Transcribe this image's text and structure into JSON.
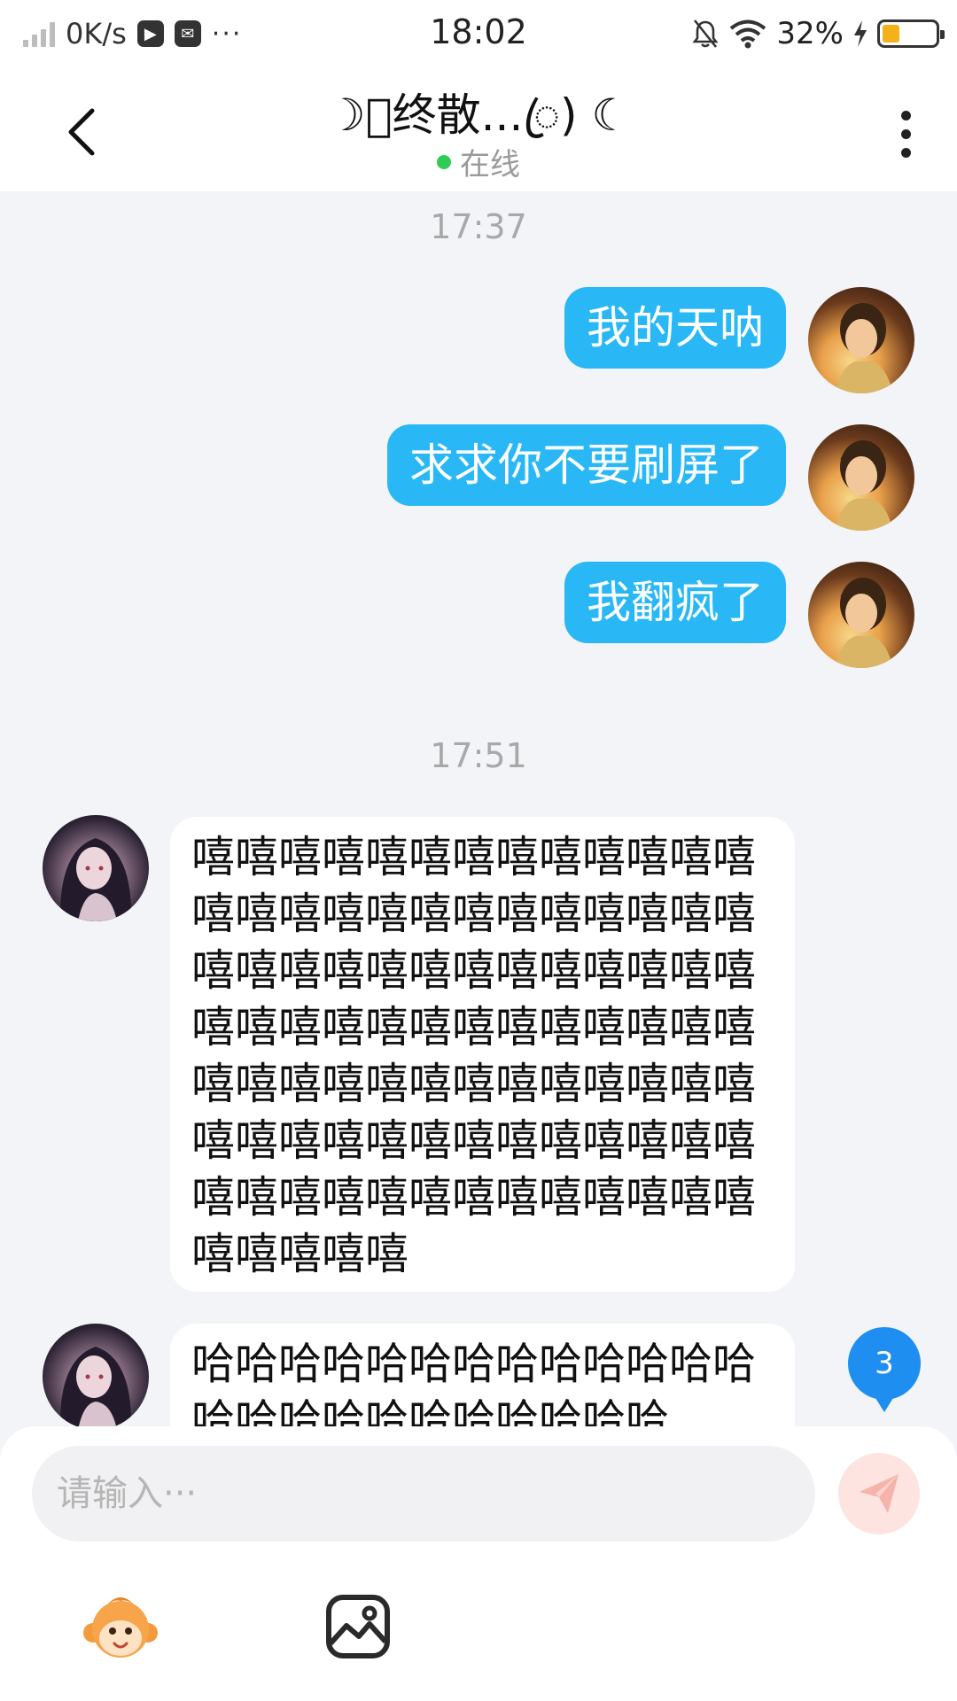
{
  "status_bar": {
    "speed": "0K/s",
    "time": "18:02",
    "battery": "32%",
    "battery_level": 0.32,
    "dots": "···"
  },
  "header": {
    "title": "☽ꦿ终散...ꦿ) ☾",
    "status": "在线",
    "online_color": "#2ecc54"
  },
  "messages": [
    {
      "type": "timestamp",
      "text": "17:37"
    },
    {
      "type": "outgoing",
      "text": "我的天呐"
    },
    {
      "type": "outgoing",
      "text": "求求你不要刷屏了"
    },
    {
      "type": "outgoing",
      "text": "我翻疯了"
    },
    {
      "type": "timestamp",
      "text": "17:51"
    },
    {
      "type": "incoming",
      "text": "嘻嘻嘻嘻嘻嘻嘻嘻嘻嘻嘻嘻嘻嘻嘻嘻嘻嘻嘻嘻嘻嘻嘻嘻嘻嘻嘻嘻嘻嘻嘻嘻嘻嘻嘻嘻嘻嘻嘻嘻嘻嘻嘻嘻嘻嘻嘻嘻嘻嘻嘻嘻嘻嘻嘻嘻嘻嘻嘻嘻嘻嘻嘻嘻嘻嘻嘻嘻嘻嘻嘻嘻嘻嘻嘻嘻嘻嘻嘻嘻嘻嘻嘻嘻嘻嘻嘻嘻嘻嘻嘻嘻嘻嘻嘻嘻"
    },
    {
      "type": "incoming",
      "text": "哈哈哈哈哈哈哈哈哈哈哈哈哈哈哈哈哈哈哈哈哈哈哈哈"
    }
  ],
  "unread_count": "3",
  "input": {
    "placeholder": "请输入···",
    "value": ""
  },
  "icons": {
    "back": "chevron-left-icon",
    "more": "more-vertical-icon",
    "send": "send-icon",
    "sticker": "monkey-sticker-icon",
    "image": "image-icon"
  },
  "colors": {
    "outgoing_bubble": "#29b8f5",
    "badge": "#1e8ef0",
    "send_disabled": "#fde4e1"
  }
}
